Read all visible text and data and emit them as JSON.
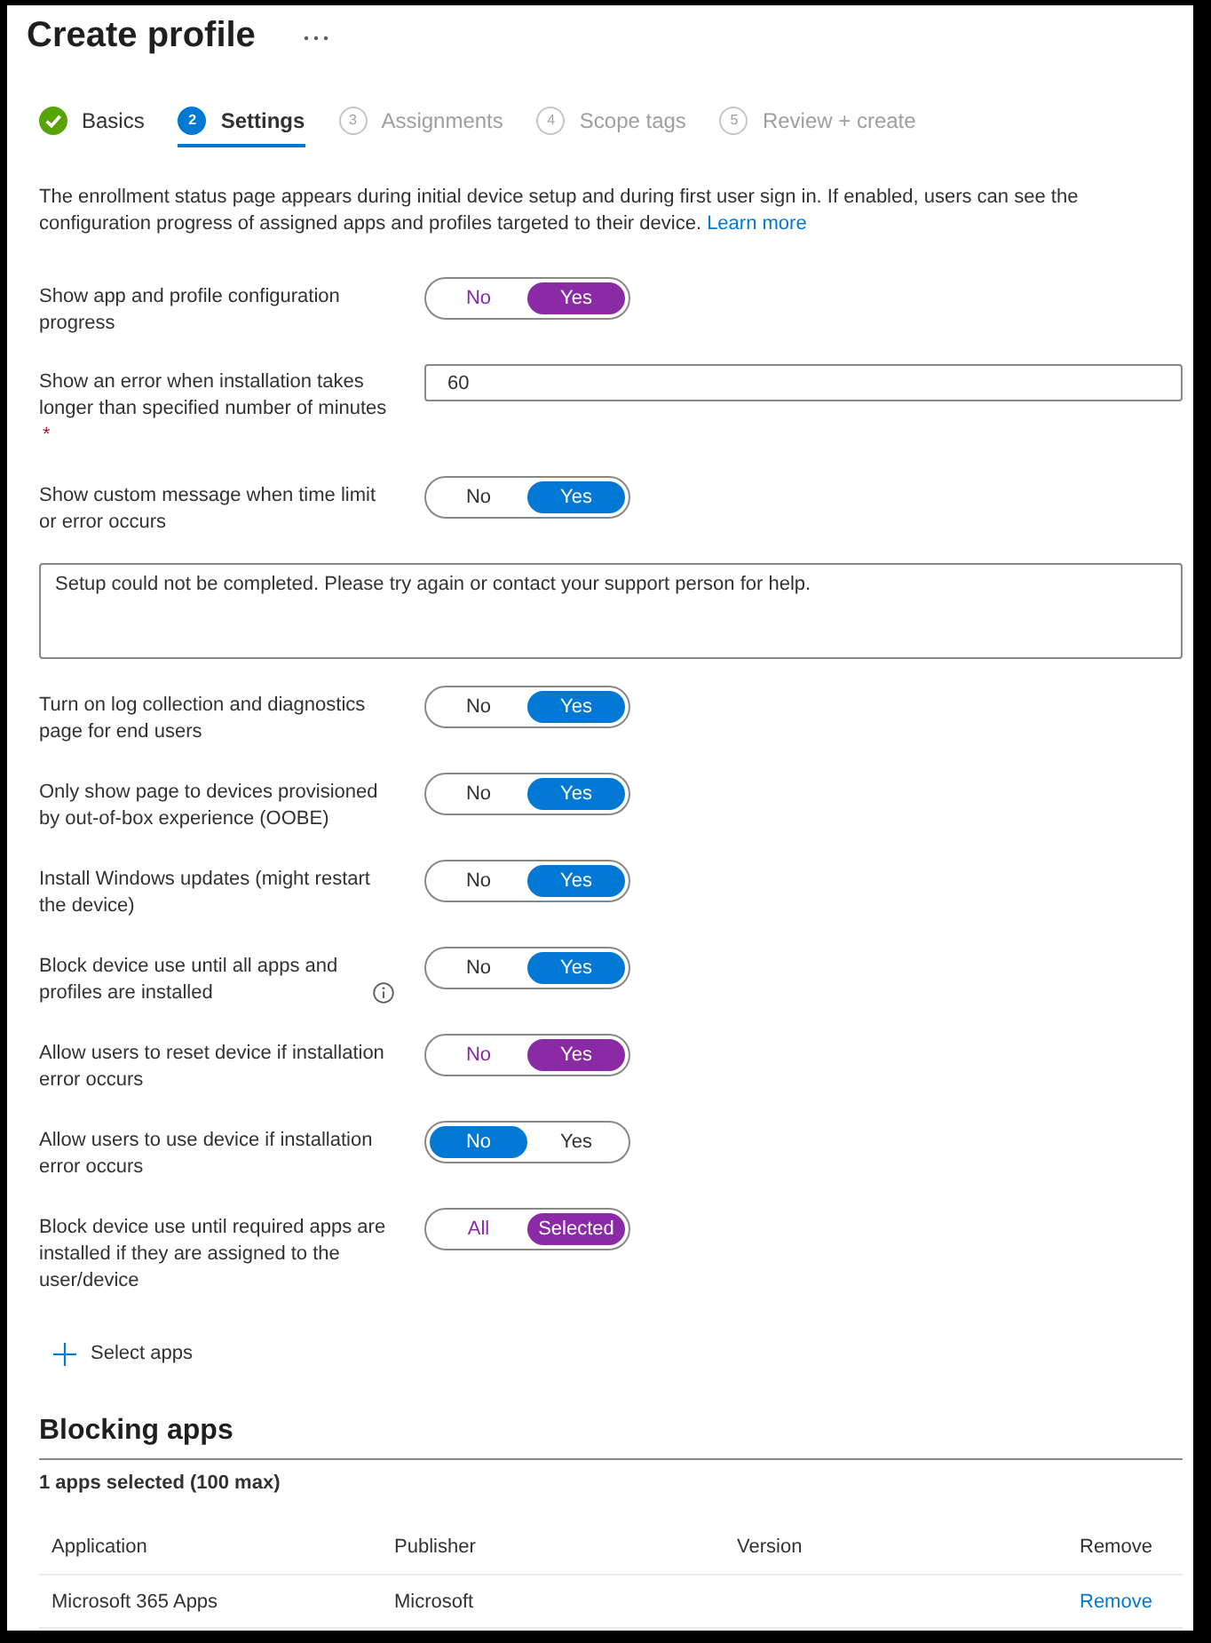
{
  "header": {
    "title": "Create profile"
  },
  "steps": [
    {
      "label": "Basics",
      "completed": true,
      "selected": false
    },
    {
      "number": "2",
      "label": "Settings",
      "completed": false,
      "selected": true
    },
    {
      "number": "3",
      "label": "Assignments",
      "completed": false,
      "selected": false
    },
    {
      "number": "4",
      "label": "Scope tags",
      "completed": false,
      "selected": false
    },
    {
      "number": "5",
      "label": "Review + create",
      "completed": false,
      "selected": false
    }
  ],
  "description": {
    "text": "The enrollment status page appears during initial device setup and during first user sign in. If enabled, users can see the configuration progress of assigned apps and profiles targeted to their device.",
    "link": "Learn more"
  },
  "settings": [
    {
      "kind": "toggle",
      "label": "Show app and profile configuration progress",
      "modified": true,
      "info": false,
      "options": [
        {
          "label": "No",
          "selected": false
        },
        {
          "label": "Yes",
          "selected": true
        }
      ]
    },
    {
      "kind": "field",
      "label": "Show an error when installation takes longer than specified number of minutes",
      "required_mark": "*",
      "value": "60"
    },
    {
      "kind": "toggle",
      "label": "Show custom message when time limit or error occurs",
      "modified": false,
      "info": false,
      "options": [
        {
          "label": "No",
          "selected": false
        },
        {
          "label": "Yes",
          "selected": true
        }
      ]
    },
    {
      "kind": "textarea",
      "value": "Setup could not be completed. Please try again or contact your support person for help."
    },
    {
      "kind": "toggle",
      "label": "Turn on log collection and diagnostics page for end users",
      "modified": false,
      "info": false,
      "options": [
        {
          "label": "No",
          "selected": false
        },
        {
          "label": "Yes",
          "selected": true
        }
      ]
    },
    {
      "kind": "toggle",
      "label": "Only show page to devices provisioned by out-of-box experience (OOBE)",
      "modified": false,
      "info": false,
      "options": [
        {
          "label": "No",
          "selected": false
        },
        {
          "label": "Yes",
          "selected": true
        }
      ]
    },
    {
      "kind": "toggle",
      "label": "Install Windows updates (might restart the device)",
      "modified": false,
      "info": false,
      "options": [
        {
          "label": "No",
          "selected": false
        },
        {
          "label": "Yes",
          "selected": true
        }
      ]
    },
    {
      "kind": "toggle",
      "label": "Block device use until all apps and profiles are installed",
      "modified": false,
      "info": true,
      "options": [
        {
          "label": "No",
          "selected": false
        },
        {
          "label": "Yes",
          "selected": true
        }
      ]
    },
    {
      "kind": "toggle",
      "label": "Allow users to reset device if installation error occurs",
      "modified": true,
      "info": false,
      "options": [
        {
          "label": "No",
          "selected": false
        },
        {
          "label": "Yes",
          "selected": true
        }
      ]
    },
    {
      "kind": "toggle",
      "label": "Allow users to use device if installation error occurs",
      "modified": false,
      "info": false,
      "options": [
        {
          "label": "No",
          "selected": true
        },
        {
          "label": "Yes",
          "selected": false
        }
      ]
    },
    {
      "kind": "toggle",
      "label": "Block device use until required apps are installed if they are assigned to the user/device",
      "modified": true,
      "info": false,
      "options": [
        {
          "label": "All",
          "selected": false
        },
        {
          "label": "Selected",
          "selected": true
        }
      ]
    }
  ],
  "select_apps": {
    "label": "Select apps"
  },
  "blocking_apps": {
    "title": "Blocking apps",
    "summary": "1 apps selected (100 max)",
    "table": {
      "columns": [
        "Application",
        "Publisher",
        "Version",
        "Remove"
      ],
      "rows": [
        {
          "application": "Microsoft 365 Apps",
          "publisher": "Microsoft",
          "action": "Remove"
        }
      ]
    }
  }
}
